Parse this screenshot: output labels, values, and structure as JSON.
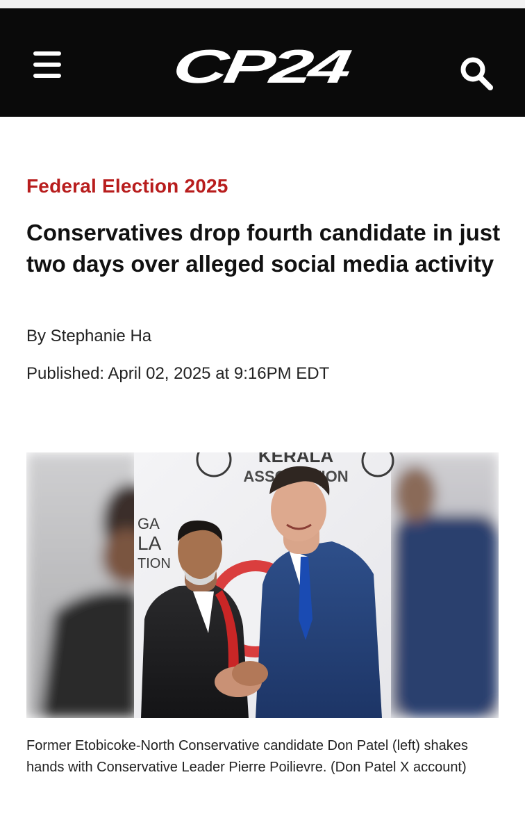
{
  "header": {
    "logo_text": "CP24",
    "menu_icon": "hamburger-menu-icon",
    "search_icon": "search-icon",
    "background": "#0a0a0a"
  },
  "article": {
    "section": "Federal Election 2025",
    "section_color": "#b81d1d",
    "headline": "Conservatives drop fourth candidate in just two days over alleged social media activity",
    "byline": "By Stephanie Ha",
    "published": "Published: April 02, 2025 at 9:16PM EDT",
    "photo": {
      "backdrop_text_1": "KERALA",
      "backdrop_text_2": "ASSOCIATION",
      "backdrop_fragment_1": "GA",
      "backdrop_fragment_2": "LA",
      "backdrop_fragment_3": "TION"
    },
    "caption": "Former Etobicoke-North Conservative candidate Don Patel (left) shakes hands with Conservative Leader Pierre Poilievre. (Don Patel X account)"
  }
}
